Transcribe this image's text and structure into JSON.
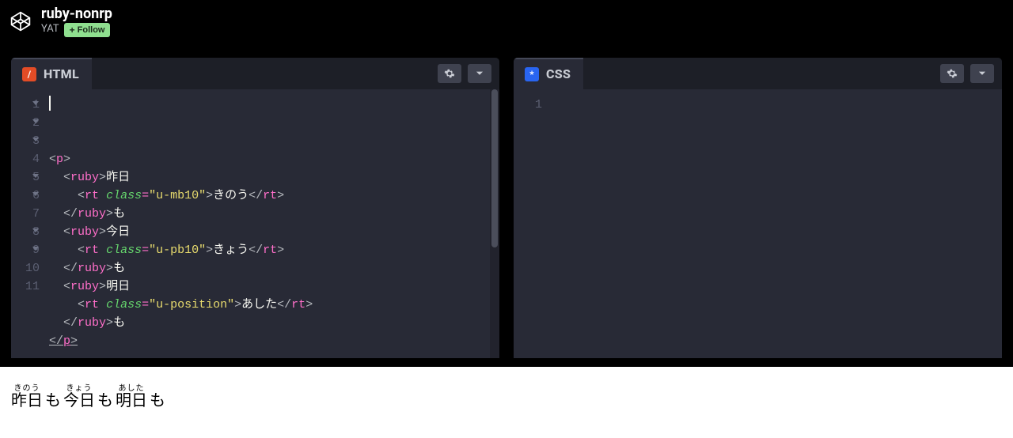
{
  "header": {
    "title": "ruby-nonrp",
    "author": "YAT",
    "follow": "Follow"
  },
  "panels": {
    "html": {
      "label": "HTML"
    },
    "css": {
      "label": "CSS"
    }
  },
  "html_code": {
    "gutter": [
      "1",
      "2",
      "3",
      "4",
      "5",
      "6",
      "7",
      "8",
      "9",
      "10",
      "11"
    ],
    "folds": [
      true,
      true,
      true,
      false,
      true,
      true,
      false,
      true,
      true,
      false,
      false
    ],
    "lines": [
      [
        {
          "cls": "t-bracket",
          "t": "<"
        },
        {
          "cls": "t-tag",
          "t": "p"
        },
        {
          "cls": "t-bracket",
          "t": ">"
        }
      ],
      [
        {
          "cls": "ind",
          "t": "  "
        },
        {
          "cls": "t-bracket",
          "t": "<"
        },
        {
          "cls": "t-tag",
          "t": "ruby"
        },
        {
          "cls": "t-bracket",
          "t": ">"
        },
        {
          "cls": "t-text",
          "t": "昨日"
        }
      ],
      [
        {
          "cls": "ind",
          "t": "    "
        },
        {
          "cls": "t-bracket",
          "t": "<"
        },
        {
          "cls": "t-tag",
          "t": "rt"
        },
        {
          "cls": "",
          "t": " "
        },
        {
          "cls": "t-attr",
          "t": "class"
        },
        {
          "cls": "t-eq",
          "t": "="
        },
        {
          "cls": "t-str",
          "t": "\"u-mb10\""
        },
        {
          "cls": "t-bracket",
          "t": ">"
        },
        {
          "cls": "t-text",
          "t": "きのう"
        },
        {
          "cls": "t-bracket",
          "t": "</"
        },
        {
          "cls": "t-tag",
          "t": "rt"
        },
        {
          "cls": "t-bracket",
          "t": ">"
        }
      ],
      [
        {
          "cls": "ind",
          "t": "  "
        },
        {
          "cls": "t-bracket",
          "t": "</"
        },
        {
          "cls": "t-tag",
          "t": "ruby"
        },
        {
          "cls": "t-bracket",
          "t": ">"
        },
        {
          "cls": "t-text",
          "t": "も"
        }
      ],
      [
        {
          "cls": "ind",
          "t": "  "
        },
        {
          "cls": "t-bracket",
          "t": "<"
        },
        {
          "cls": "t-tag",
          "t": "ruby"
        },
        {
          "cls": "t-bracket",
          "t": ">"
        },
        {
          "cls": "t-text",
          "t": "今日"
        }
      ],
      [
        {
          "cls": "ind",
          "t": "    "
        },
        {
          "cls": "t-bracket",
          "t": "<"
        },
        {
          "cls": "t-tag",
          "t": "rt"
        },
        {
          "cls": "",
          "t": " "
        },
        {
          "cls": "t-attr",
          "t": "class"
        },
        {
          "cls": "t-eq",
          "t": "="
        },
        {
          "cls": "t-str",
          "t": "\"u-pb10\""
        },
        {
          "cls": "t-bracket",
          "t": ">"
        },
        {
          "cls": "t-text",
          "t": "きょう"
        },
        {
          "cls": "t-bracket",
          "t": "</"
        },
        {
          "cls": "t-tag",
          "t": "rt"
        },
        {
          "cls": "t-bracket",
          "t": ">"
        }
      ],
      [
        {
          "cls": "ind",
          "t": "  "
        },
        {
          "cls": "t-bracket",
          "t": "</"
        },
        {
          "cls": "t-tag",
          "t": "ruby"
        },
        {
          "cls": "t-bracket",
          "t": ">"
        },
        {
          "cls": "t-text",
          "t": "も"
        }
      ],
      [
        {
          "cls": "ind",
          "t": "  "
        },
        {
          "cls": "t-bracket",
          "t": "<"
        },
        {
          "cls": "t-tag",
          "t": "ruby"
        },
        {
          "cls": "t-bracket",
          "t": ">"
        },
        {
          "cls": "t-text",
          "t": "明日"
        }
      ],
      [
        {
          "cls": "ind",
          "t": "    "
        },
        {
          "cls": "t-bracket",
          "t": "<"
        },
        {
          "cls": "t-tag",
          "t": "rt"
        },
        {
          "cls": "",
          "t": " "
        },
        {
          "cls": "t-attr",
          "t": "class"
        },
        {
          "cls": "t-eq",
          "t": "="
        },
        {
          "cls": "t-str",
          "t": "\"u-position\""
        },
        {
          "cls": "t-bracket",
          "t": ">"
        },
        {
          "cls": "t-text",
          "t": "あした"
        },
        {
          "cls": "t-bracket",
          "t": "</"
        },
        {
          "cls": "t-tag",
          "t": "rt"
        },
        {
          "cls": "t-bracket",
          "t": ">"
        }
      ],
      [
        {
          "cls": "ind",
          "t": "  "
        },
        {
          "cls": "t-bracket",
          "t": "</"
        },
        {
          "cls": "t-tag",
          "t": "ruby"
        },
        {
          "cls": "t-bracket",
          "t": ">"
        },
        {
          "cls": "t-text",
          "t": "も"
        }
      ],
      [
        {
          "cls": "t-bracket under",
          "t": "</"
        },
        {
          "cls": "t-tag under",
          "t": "p"
        },
        {
          "cls": "t-bracket under",
          "t": ">"
        }
      ]
    ]
  },
  "css_code": {
    "gutter": [
      "1"
    ]
  },
  "output": {
    "items": [
      {
        "base": "昨日",
        "rt": "きのう"
      },
      {
        "base": "今日",
        "rt": "きょう"
      },
      {
        "base": "明日",
        "rt": "あした"
      }
    ],
    "particle": "も"
  }
}
